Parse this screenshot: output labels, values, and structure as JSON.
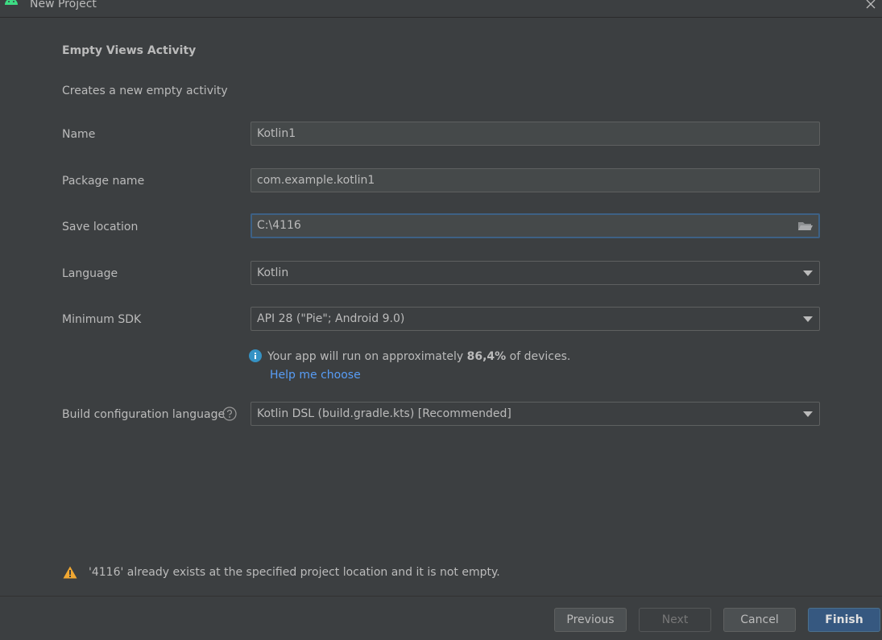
{
  "window": {
    "title": "New Project"
  },
  "header": {
    "title": "Empty Views Activity",
    "description": "Creates a new empty activity"
  },
  "form": {
    "name": {
      "label": "Name",
      "value": "Kotlin1"
    },
    "package": {
      "label": "Package name",
      "value": "com.example.kotlin1"
    },
    "save_location": {
      "label": "Save location",
      "value": "C:\\4116"
    },
    "language": {
      "label": "Language",
      "value": "Kotlin"
    },
    "min_sdk": {
      "label": "Minimum SDK",
      "value": "API 28 (\"Pie\"; Android 9.0)"
    },
    "build_config": {
      "label": "Build configuration language",
      "value": "Kotlin DSL (build.gradle.kts) [Recommended]"
    }
  },
  "info": {
    "prefix": "Your app will run on approximately ",
    "percent": "86,4%",
    "suffix": " of devices.",
    "help_link": "Help me choose"
  },
  "warning": {
    "text": "'4116' already exists at the specified project location and it is not empty."
  },
  "buttons": {
    "previous": "Previous",
    "next": "Next",
    "cancel": "Cancel",
    "finish": "Finish"
  },
  "colors": {
    "background": "#3c3f41",
    "accent": "#365880",
    "link": "#589df6",
    "info": "#3592c4",
    "warning": "#f0a732",
    "android": "#3ddc84"
  },
  "icons": [
    "android-icon",
    "close-icon",
    "folder-icon",
    "dropdown-arrow-icon",
    "info-icon",
    "help-icon",
    "warning-icon"
  ]
}
